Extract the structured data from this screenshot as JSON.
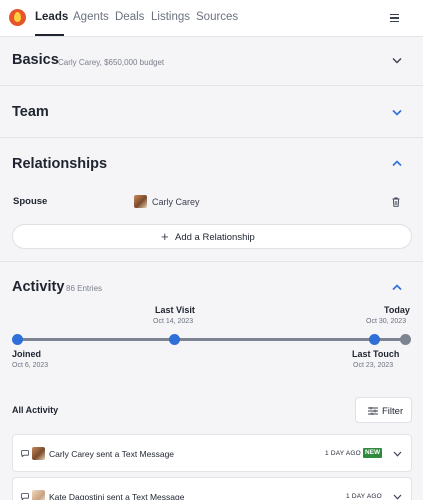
{
  "nav": {
    "tabs": [
      {
        "label": "Leads",
        "active": true
      },
      {
        "label": "Agents",
        "active": false
      },
      {
        "label": "Deals",
        "active": false
      },
      {
        "label": "Listings",
        "active": false
      },
      {
        "label": "Sources",
        "active": false
      }
    ],
    "menu_icon": "hamburger-icon"
  },
  "sections": {
    "basics": {
      "title": "Basics",
      "subtitle": "Carly Carey, $650,000 budget"
    },
    "team": {
      "title": "Team"
    },
    "relationships": {
      "title": "Relationships",
      "items": [
        {
          "role": "Spouse",
          "name": "Carly Carey"
        }
      ],
      "add_label": "Add a Relationship"
    },
    "activity": {
      "title": "Activity",
      "count_text": "86 Entries"
    }
  },
  "timeline": {
    "points": [
      {
        "label": "Joined",
        "date": "Oct 6, 2023"
      },
      {
        "label": "Last Visit",
        "date": "Oct 14, 2023"
      },
      {
        "label": "Last Touch",
        "date": "Oct 23, 2023"
      },
      {
        "label": "Today",
        "date": "Oct 30, 2023"
      }
    ]
  },
  "all_activity": {
    "heading": "All Activity",
    "filter_label": "Filter",
    "entries": [
      {
        "text": "Carly Carey sent a Text Message",
        "ago": "1 DAY AGO",
        "badge": "NEW"
      },
      {
        "text": "Kate Dagostini sent a Text Message",
        "ago": "1 DAY AGO",
        "badge": ""
      }
    ]
  },
  "colors": {
    "accent_blue": "#2f6fd8",
    "new_badge": "#2f8a3e",
    "timeline_gray": "#7e8391"
  }
}
